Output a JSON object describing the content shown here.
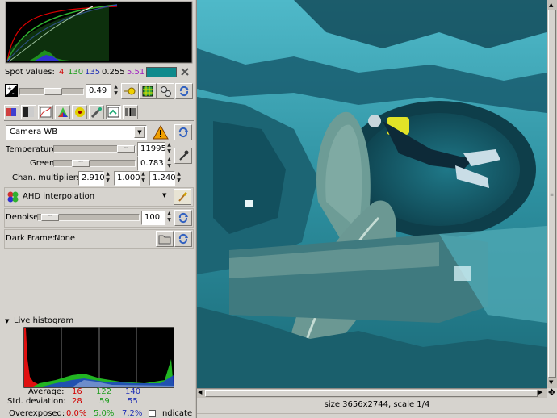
{
  "spot": {
    "label": "Spot values:",
    "r": "4",
    "g": "130",
    "b": "135",
    "lum": "0.255",
    "hue": "5.51",
    "swatch_color": "#0e8a8c",
    "r_color": "#d00000",
    "g_color": "#1e9e1e",
    "b_color": "#1f2fb5",
    "hue_color": "#a020c0"
  },
  "exposure": {
    "value": "0.49",
    "level": 0.33
  },
  "wb": {
    "preset": "Camera WB",
    "temperature_label": "Temperature",
    "temperature_value": "11995",
    "temperature_level": 0.95,
    "green_label": "Green",
    "green_value": "0.783",
    "green_level": 0.3,
    "chan_label": "Chan. multipliers:",
    "chan": [
      "2.910",
      "1.000",
      "1.240"
    ]
  },
  "interpolation": {
    "value": "AHD interpolation"
  },
  "denoise": {
    "label": "Denoise",
    "value": "100",
    "level": 0.1
  },
  "darkframe": {
    "label": "Dark Frame:",
    "value": "None"
  },
  "live_histogram": {
    "title": "Live histogram",
    "average_label": "Average:",
    "average": [
      "16",
      "122",
      "140"
    ],
    "std_label": "Std. deviation:",
    "std": [
      "28",
      "59",
      "55"
    ],
    "overexposed_label": "Overexposed:",
    "overexposed": [
      "0.0%",
      "5.0%",
      "7.2%"
    ],
    "indicate_label": "Indicate"
  },
  "status": {
    "text": "size 3656x2744, scale 1/4"
  },
  "icons": {
    "close": "close-icon",
    "warning": "warning-icon",
    "refresh": "refresh-icon",
    "eyedropper": "eyedropper-icon",
    "brush": "brush-icon",
    "folder": "folder-icon"
  }
}
